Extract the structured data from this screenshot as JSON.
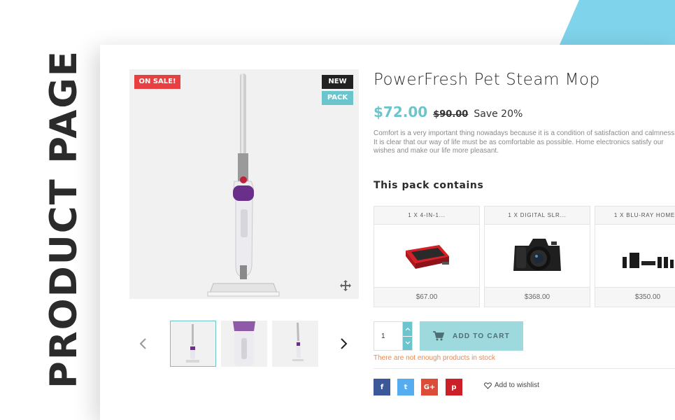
{
  "side_title": "PRODUCT PAGE",
  "badges": {
    "sale": "On sale!",
    "new": "New",
    "pack": "Pack"
  },
  "product": {
    "title": "PowerFresh Pet Steam Mop",
    "price": "$72.00",
    "old_price": "$90.00",
    "discount": "Save 20%",
    "description": "Comfort is a very important thing nowadays because it is a condition of satisfaction and calmness. It is clear that our way of life must be as comfortable as possible. Home electronics satisfy our wishes and make our life more pleasant."
  },
  "pack": {
    "heading": "This pack contains",
    "items": [
      {
        "name": "1 x 4-in-1...",
        "price": "$67.00"
      },
      {
        "name": "1 x Digital SLR...",
        "price": "$368.00"
      },
      {
        "name": "1 x Blu-ray Home...",
        "price": "$350.00"
      }
    ]
  },
  "cart": {
    "quantity": "1",
    "add_label": "Add to cart",
    "stock_message": "There are not enough products in stock"
  },
  "social": {
    "facebook": "f",
    "twitter": "t",
    "googleplus": "G+",
    "pinterest": "p"
  },
  "wishlist_label": "Add to wishlist",
  "colors": {
    "accent": "#6cc4cd",
    "sale": "#e84042",
    "warning": "#f0874b"
  },
  "icons": [
    "expand-icon",
    "chevron-left-icon",
    "chevron-right-icon",
    "cart-icon",
    "heart-icon",
    "spinner-up-icon",
    "spinner-down-icon"
  ]
}
